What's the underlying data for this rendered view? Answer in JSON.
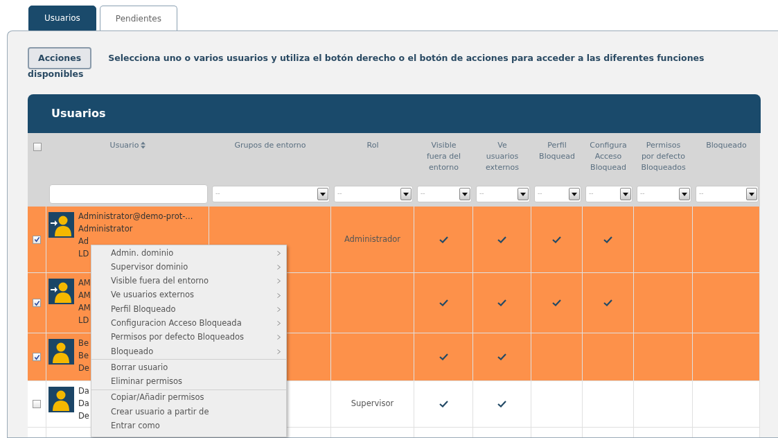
{
  "tabs": [
    {
      "label": "Usuarios",
      "selected": true
    },
    {
      "label": "Pendientes",
      "selected": false
    }
  ],
  "actions_button": "Acciones",
  "instruction": [
    "Selecciona uno o varios usuarios y utiliza el botón derecho o el botón de acciones para acceder a las diferentes funciones",
    "disponibles"
  ],
  "table": {
    "title": "Usuarios",
    "select_all": {
      "checked": false
    },
    "columns": [
      {
        "lines": [
          "Usuario"
        ],
        "sortable": true
      },
      {
        "lines": [
          "Grupos de entorno"
        ]
      },
      {
        "lines": [
          "Rol"
        ]
      },
      {
        "lines": [
          "Visible",
          "fuera del",
          "entorno"
        ]
      },
      {
        "lines": [
          "Ve",
          "usuarios",
          "externos"
        ]
      },
      {
        "lines": [
          "Perfil",
          "Bloquead"
        ]
      },
      {
        "lines": [
          "Configura",
          "Acceso",
          "Bloquead"
        ]
      },
      {
        "lines": [
          "Permisos",
          "por defecto",
          "Bloqueados"
        ]
      },
      {
        "lines": [
          "Bloqueado"
        ]
      }
    ],
    "filters": [
      {
        "kind": "text"
      },
      {
        "kind": "select",
        "value": "--"
      },
      {
        "kind": "select",
        "value": "--"
      },
      {
        "kind": "select",
        "value": "--"
      },
      {
        "kind": "select",
        "value": "--"
      },
      {
        "kind": "select",
        "value": "--"
      },
      {
        "kind": "select",
        "value": "--"
      },
      {
        "kind": "select",
        "value": "--"
      },
      {
        "kind": "select",
        "value": "--"
      }
    ],
    "rows": [
      {
        "selected": true,
        "login_arrow": true,
        "lines": [
          "Administrator@demo-prot-...",
          "Administrator",
          "Ad",
          "LD"
        ],
        "rol": "Administrador",
        "checks": [
          true,
          true,
          true,
          true,
          false,
          false
        ]
      },
      {
        "selected": true,
        "login_arrow": true,
        "lines": [
          "AM",
          "AM",
          "AM",
          "LD"
        ],
        "rol": "",
        "checks": [
          true,
          true,
          true,
          true,
          false,
          false
        ]
      },
      {
        "selected": true,
        "login_arrow": false,
        "lines": [
          "Be",
          "Be",
          "De"
        ],
        "rol": "",
        "checks": [
          true,
          true,
          false,
          false,
          false,
          false
        ]
      },
      {
        "selected": false,
        "login_arrow": false,
        "lines": [
          "Da",
          "Da",
          "De"
        ],
        "rol": "Supervisor",
        "checks": [
          true,
          true,
          false,
          false,
          false,
          false
        ]
      }
    ]
  },
  "context_menu": {
    "sections": [
      [
        {
          "label": "Admin. dominio",
          "submenu": true
        },
        {
          "label": "Supervisor dominio",
          "submenu": true
        },
        {
          "label": "Visible fuera del entorno",
          "submenu": true
        },
        {
          "label": "Ve usuarios externos",
          "submenu": true
        },
        {
          "label": "Perfil Bloqueado",
          "submenu": true
        },
        {
          "label": "Configuracion Acceso Bloqueada",
          "submenu": true
        },
        {
          "label": "Permisos por defecto Bloqueados",
          "submenu": true
        },
        {
          "label": "Bloqueado",
          "submenu": true
        }
      ],
      [
        {
          "label": "Borrar usuario",
          "submenu": false
        },
        {
          "label": "Eliminar permisos",
          "submenu": false
        }
      ],
      [
        {
          "label": "Copiar/Añadir permisos",
          "submenu": false
        },
        {
          "label": "Crear usuario a partir de",
          "submenu": false
        },
        {
          "label": "Entrar como",
          "submenu": false
        }
      ]
    ]
  }
}
